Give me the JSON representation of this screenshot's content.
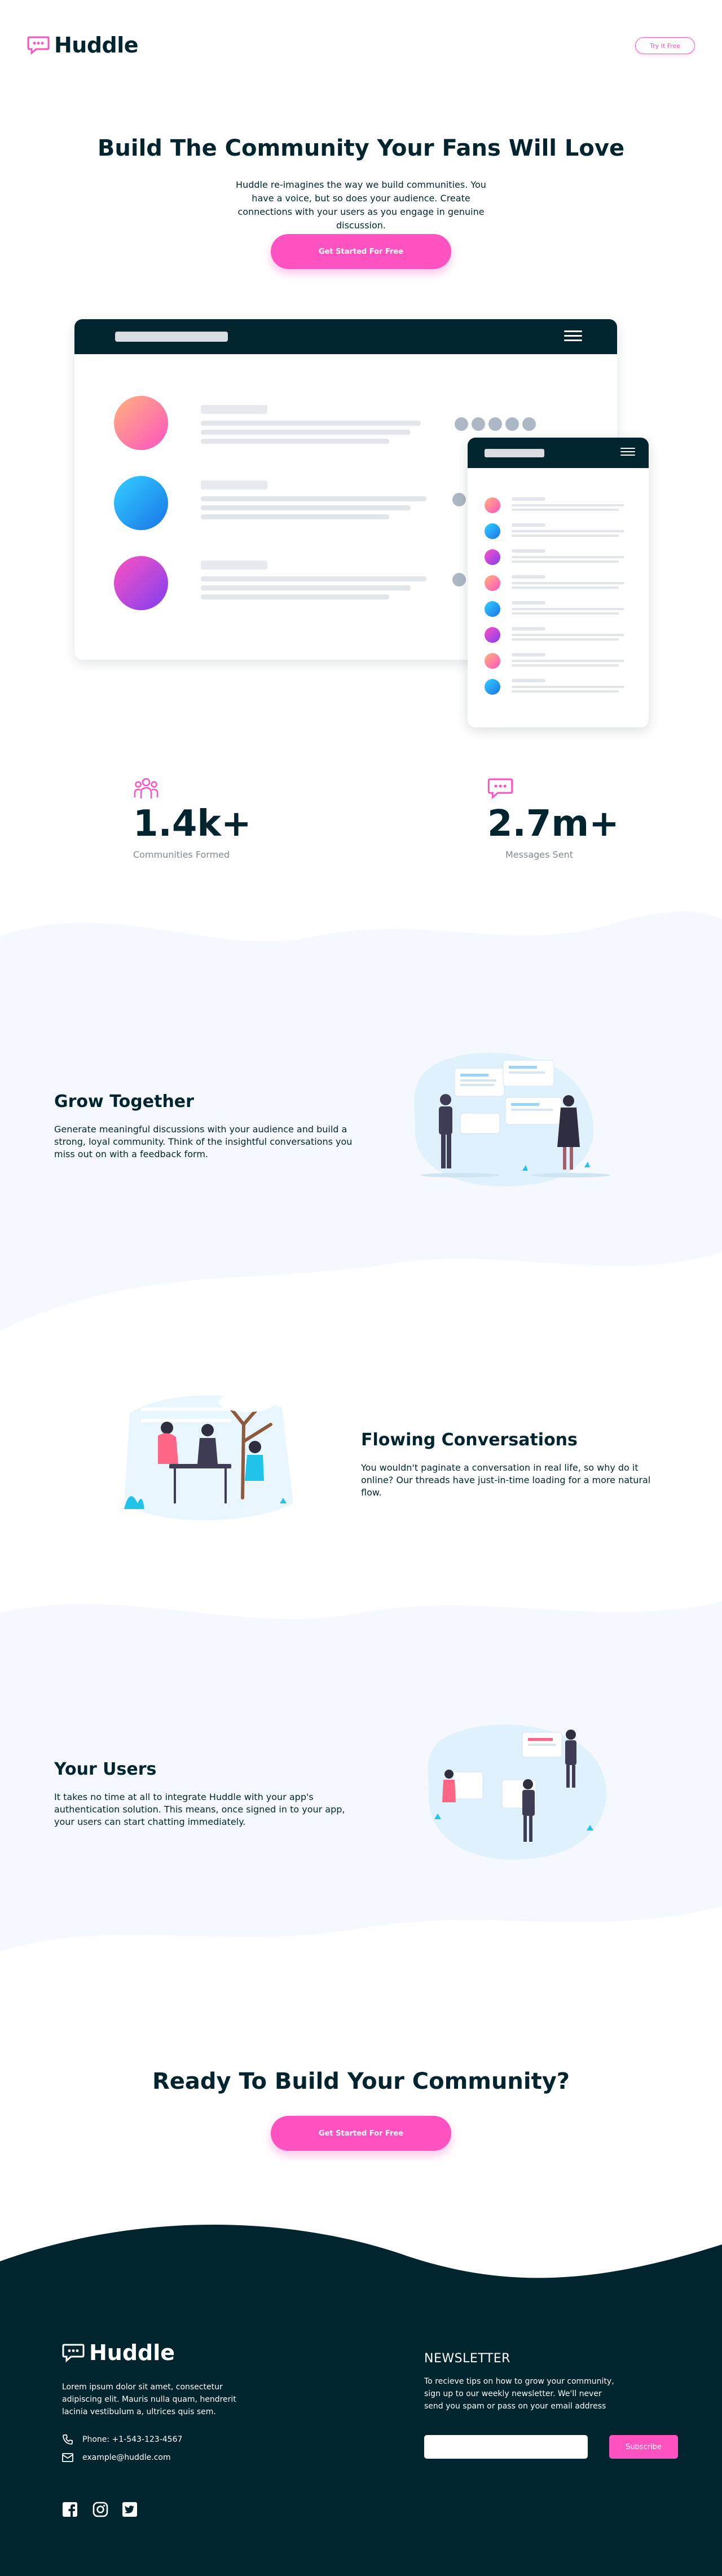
{
  "header": {
    "logo_text": "Huddle",
    "try_label": "Try It Free"
  },
  "hero": {
    "title": "Build The Community Your Fans Will Love",
    "subtitle": "Huddle re-imagines the way we build communities. You have a voice, but so does your audience. Create connections with your users as you engage in genuine discussion.",
    "cta": "Get Started For Free"
  },
  "stats": [
    {
      "icon": "users-icon",
      "value": "1.4k+",
      "label": "Communities Formed"
    },
    {
      "icon": "chat-icon",
      "value": "2.7m+",
      "label": "Messages Sent"
    }
  ],
  "features": [
    {
      "title": "Grow Together",
      "text": "Generate meaningful discussions with your audience and build a strong, loyal community. Think of the insightful conversations you miss out on with a feedback form."
    },
    {
      "title": "Flowing Conversations",
      "text": "You wouldn't paginate a conversation in real life, so why do it online? Our threads have just-in-time loading for a more natural flow."
    },
    {
      "title": "Your Users",
      "text": "It takes no time at all to integrate Huddle with your app's authentication solution. This means, once signed in to your app, your users can start chatting immediately."
    }
  ],
  "cta_section": {
    "title": "Ready To Build Your Community?",
    "button": "Get Started For Free"
  },
  "footer": {
    "logo_text": "Huddle",
    "about": "Lorem ipsum dolor sit amet, consectetur adipiscing elit. Mauris nulla quam, hendrerit lacinia vestibulum a, ultrices quis sem.",
    "phone": "Phone: +1-543-123-4567",
    "email": "example@huddle.com",
    "newsletter_title": "NEWSLETTER",
    "newsletter_text": "To recieve tips on how to grow your community, sign up to our weekly newsletter. We'll never send you spam or pass on your email address",
    "subscribe": "Subscribe",
    "socials": [
      "facebook-icon",
      "instagram-icon",
      "twitter-icon"
    ]
  },
  "colors": {
    "pink": "#ff52c1",
    "dark": "#00252e",
    "light_bg": "#f5f9ff",
    "grey": "#808a92"
  }
}
